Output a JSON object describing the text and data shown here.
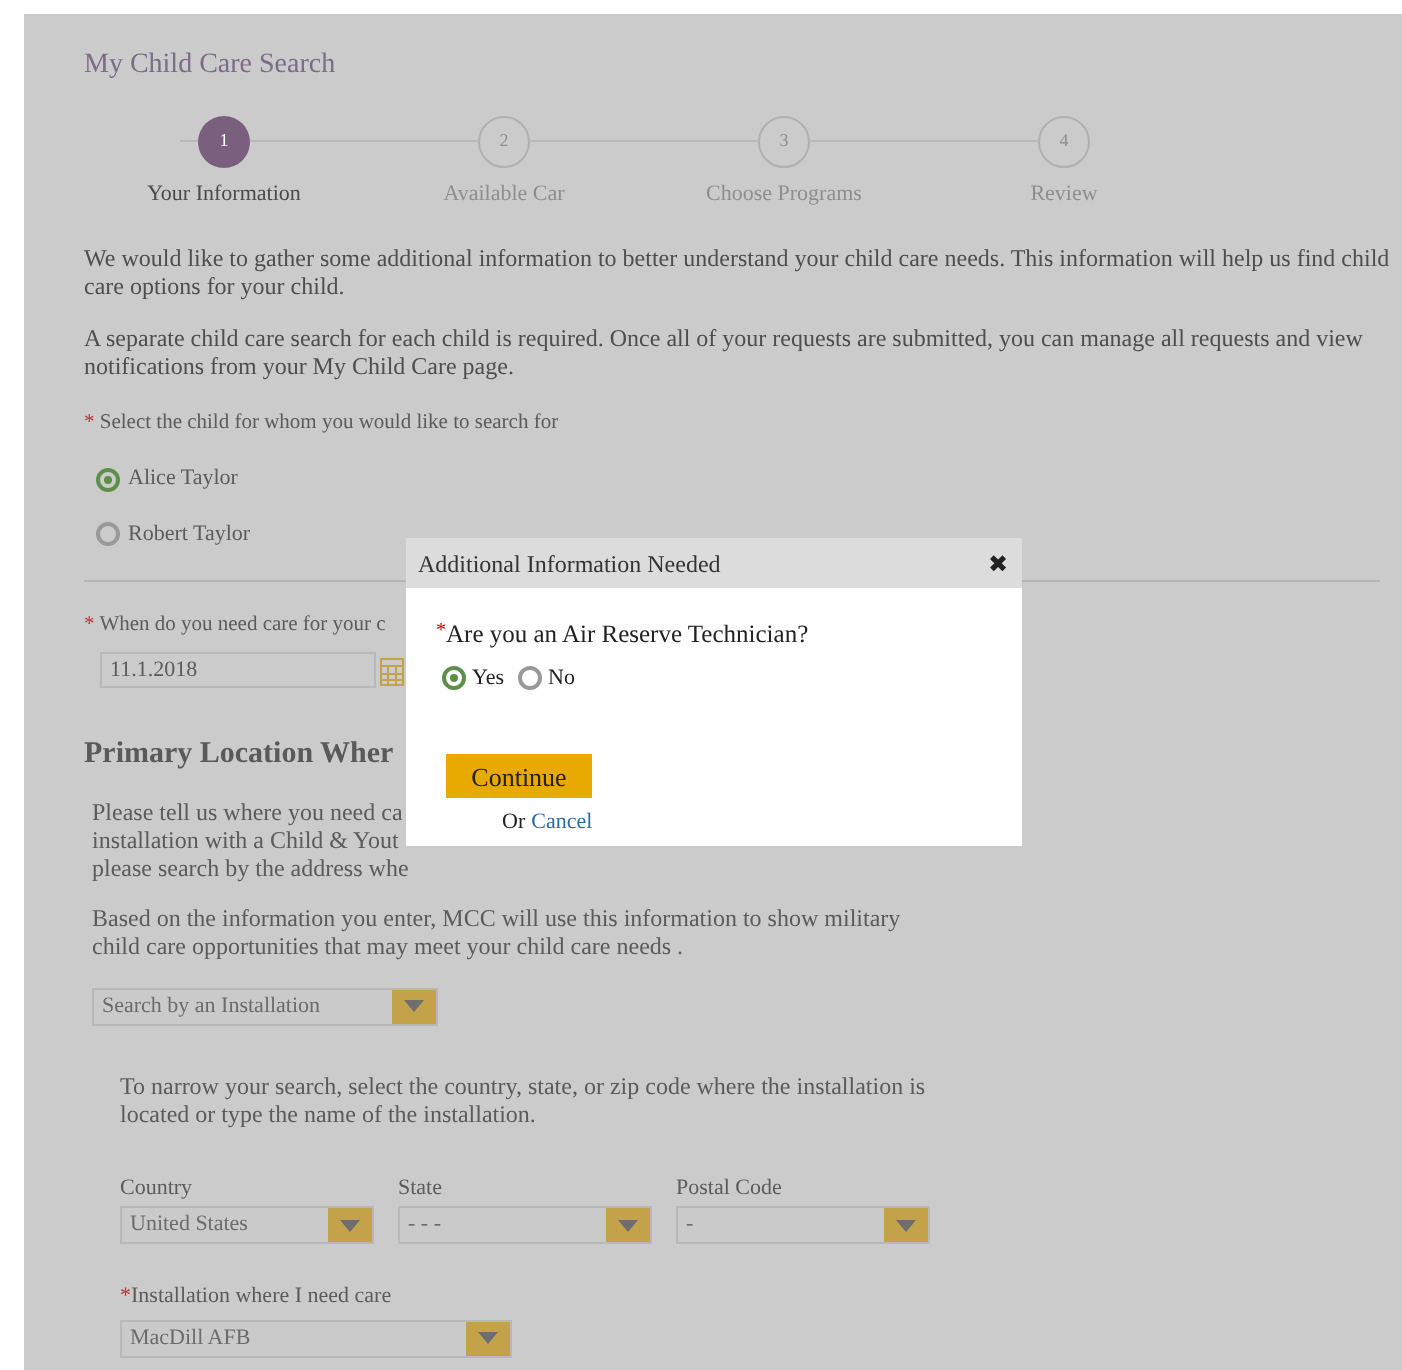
{
  "title": "My Child Care Search",
  "steps": [
    {
      "number": "1",
      "label": "Your Information",
      "selected": true
    },
    {
      "number": "2",
      "label": "Available Car",
      "selected": false
    },
    {
      "number": "3",
      "label": "Choose Programs",
      "selected": false
    },
    {
      "number": "4",
      "label": "Review",
      "selected": false
    }
  ],
  "intro": [
    "We would like to gather some additional information to better understand your child care needs. This information will help us find child care options for your child.",
    "A separate child care search for each child is required. Once all of your requests are submitted, you can manage all requests and view notifications from your My Child Care page."
  ],
  "child_question": {
    "required": "*",
    "label": "Select the child for whom you would like to search for"
  },
  "children": [
    {
      "name": "Alice Taylor",
      "selected": true
    },
    {
      "name": "Robert Taylor",
      "selected": false
    }
  ],
  "date_question": {
    "required": "*",
    "label": "When do you need care for your c",
    "value": "11.1.2018"
  },
  "location": {
    "heading": "Primary Location Wher",
    "text_lines": [
      "Please tell us where you need ca",
      "installation with a Child & Yout",
      "please search by the address whe"
    ],
    "info": "Based on the information you enter, MCC will use this information to show military child care opportunities that may meet your child care needs .",
    "search_by": "Search by an Installation",
    "narrow": "To narrow your search, select the country, state, or zip code where the installation is located or type the name of the installation.",
    "filters": [
      {
        "label": "Country",
        "value": "United States"
      },
      {
        "label": "State",
        "value": "- - -"
      },
      {
        "label": "Postal Code",
        "value": "-"
      }
    ],
    "installation": {
      "required": "*",
      "label": "Installation where I need care",
      "value": "MacDill AFB"
    }
  },
  "dialog": {
    "title": "Additional Information Needed",
    "close": "✖",
    "required": "*",
    "question": "Are you an Air Reserve Technician?",
    "options": [
      {
        "label": "Yes",
        "selected": true
      },
      {
        "label": "No",
        "selected": false
      }
    ],
    "continue": "Continue",
    "or": "Or",
    "cancel": "Cancel"
  }
}
